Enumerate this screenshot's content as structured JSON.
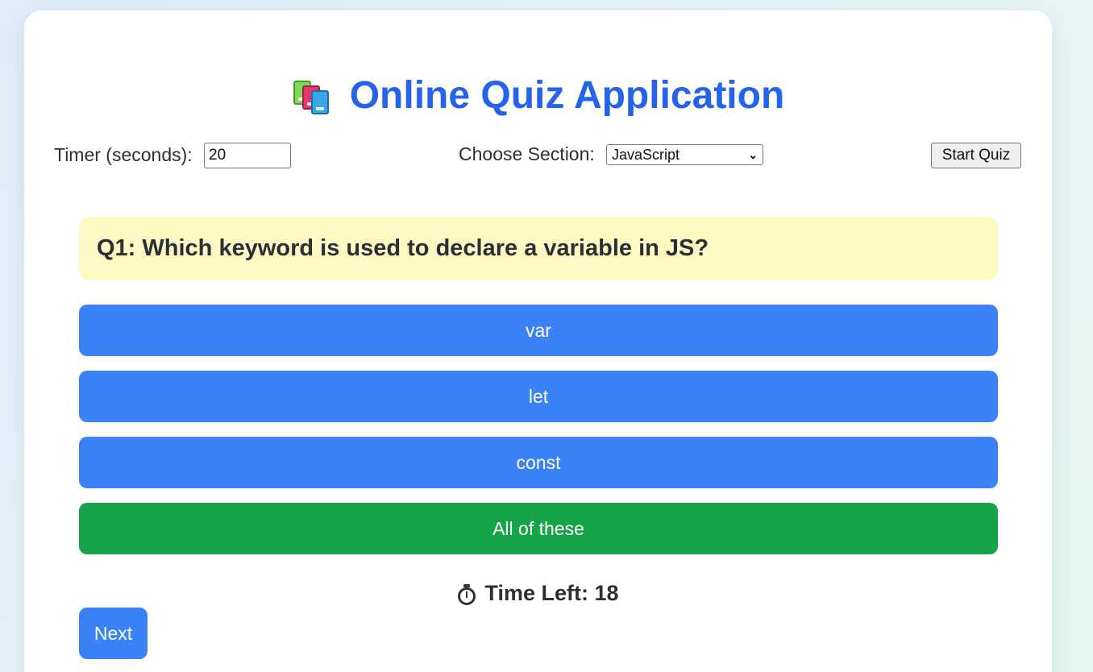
{
  "app": {
    "title": "Online Quiz Application",
    "title_icon": "books-icon",
    "accent_color": "#2563eb"
  },
  "controls": {
    "timer_label": "Timer (seconds):",
    "timer_value": "20",
    "section_label": "Choose Section:",
    "section_selected": "JavaScript",
    "start_button": "Start Quiz"
  },
  "quiz": {
    "question": "Q1: Which keyword is used to declare a variable in JS?",
    "options": [
      {
        "label": "var",
        "state": "default"
      },
      {
        "label": "let",
        "state": "default"
      },
      {
        "label": "const",
        "state": "default"
      },
      {
        "label": "All of these",
        "state": "correct"
      }
    ],
    "option_color": "#3b82f6",
    "correct_color": "#16a34a",
    "question_bg": "#fef9c3"
  },
  "status": {
    "timer_icon": "stopwatch-icon",
    "time_left_text": "Time Left: 18"
  },
  "navigation": {
    "next_button": "Next"
  }
}
